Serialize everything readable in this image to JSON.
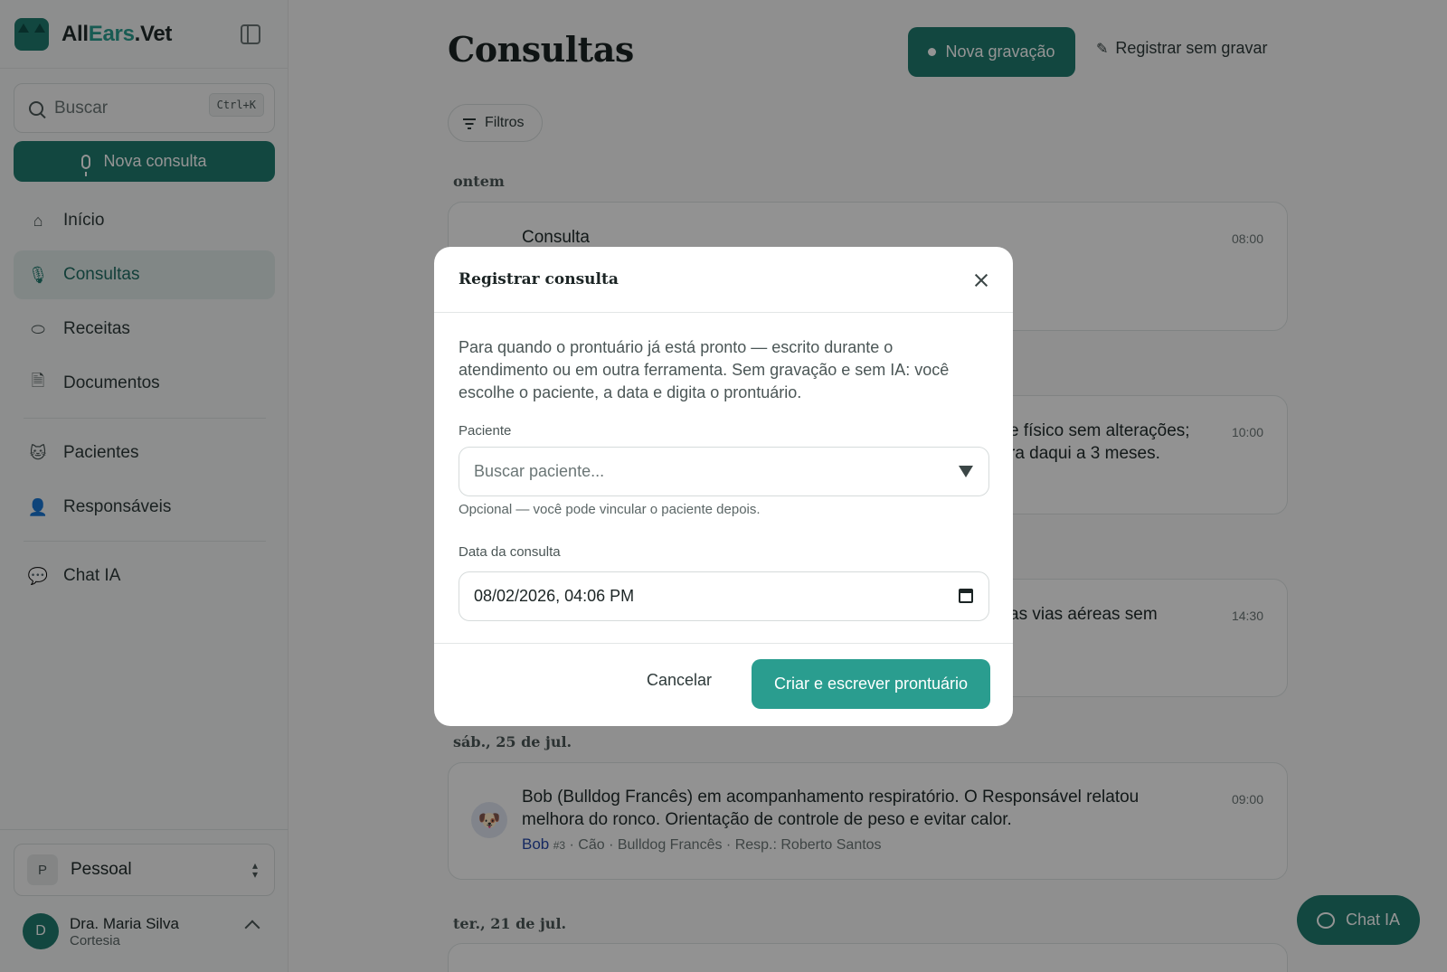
{
  "brand": {
    "name_part1": "All",
    "name_part2": "Ears",
    "name_part3": ".Vet"
  },
  "sidebar": {
    "search_placeholder": "Buscar",
    "search_shortcut": "Ctrl+K",
    "new_button": "Nova consulta",
    "items": [
      {
        "label": "Início",
        "icon": "home-icon"
      },
      {
        "label": "Consultas",
        "icon": "mic-icon",
        "active": true
      },
      {
        "label": "Receitas",
        "icon": "pill-icon"
      },
      {
        "label": "Documentos",
        "icon": "document-icon"
      },
      {
        "label": "Pacientes",
        "icon": "cat-icon"
      },
      {
        "label": "Responsáveis",
        "icon": "person-icon"
      },
      {
        "label": "Chat IA",
        "icon": "chat-icon"
      }
    ],
    "workspace": {
      "badge": "P",
      "name": "Pessoal"
    },
    "user": {
      "initial": "D",
      "name": "Dra. Maria Silva",
      "org": "Cortesia"
    }
  },
  "main": {
    "title": "Consultas",
    "primary_button": "Nova gravação",
    "secondary_button": "Registrar sem gravar",
    "filter_button": "Filtros",
    "groups": [
      {
        "label": "ontem"
      },
      {
        "label": "sáb., 25 de jul."
      },
      {
        "label": "ter., 21 de jul."
      }
    ],
    "cards": [
      {
        "title": "Consulta",
        "time": "08:00"
      },
      {
        "title_fragment_1": "e físico sem alterações;",
        "title_fragment_2": "ra daqui a 3 meses.",
        "time": "10:00"
      },
      {
        "title_fragment_1": "as vias aéreas sem",
        "time": "14:30"
      },
      {
        "title_line1": "Bob (Bulldog Francês) em acompanhamento respiratório. O Responsável relatou",
        "title_line2": "melhora do ronco. Orientação de controle de peso e evitar calor.",
        "time": "09:00",
        "pet_name": "Bob",
        "pet_num": "#3",
        "species": "Cão · Bulldog Francês",
        "owner": "Resp.: Roberto Santos"
      }
    ],
    "chat_fab": "Chat IA"
  },
  "modal": {
    "title": "Registrar consulta",
    "description": "Para quando o prontuário já está pronto — escrito durante o atendimento ou em outra ferramenta. Sem gravação e sem IA: você escolhe o paciente, a data e digita o prontuário.",
    "patient_label": "Paciente",
    "patient_placeholder": "Buscar paciente...",
    "patient_hint": "Opcional — você pode vincular o paciente depois.",
    "date_label": "Data da consulta",
    "date_value": "08/02/2026, 04:06 PM",
    "cancel": "Cancelar",
    "submit": "Criar e escrever prontuário"
  },
  "colors": {
    "accent": "#1f7a6e",
    "accent_light": "#2a9d8f",
    "link": "#2748a8"
  }
}
